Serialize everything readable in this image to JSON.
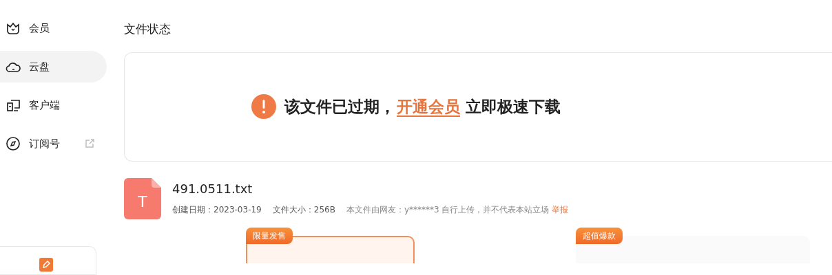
{
  "sidebar": {
    "items": [
      {
        "label": "会员",
        "kind": "crown",
        "selected": false,
        "external": false
      },
      {
        "label": "云盘",
        "kind": "cloud",
        "selected": true,
        "external": false
      },
      {
        "label": "客户端",
        "kind": "devices",
        "selected": false,
        "external": false
      },
      {
        "label": "订阅号",
        "kind": "compass",
        "selected": false,
        "external": true
      }
    ]
  },
  "file_status": {
    "title": "文件状态",
    "message": "该文件已过期，",
    "link": "开通会员",
    "suffix": "立即极速下载"
  },
  "file": {
    "type_letter": "T",
    "name": "491.0511.txt",
    "created": "创建日期：2023-03-19",
    "size": "文件大小：256B",
    "note": "本文件由网友：y******3 自行上传，并不代表本站立场",
    "report": "举报"
  },
  "promos": [
    {
      "tag": "限量发售"
    },
    {
      "tag": "超值爆款"
    }
  ]
}
